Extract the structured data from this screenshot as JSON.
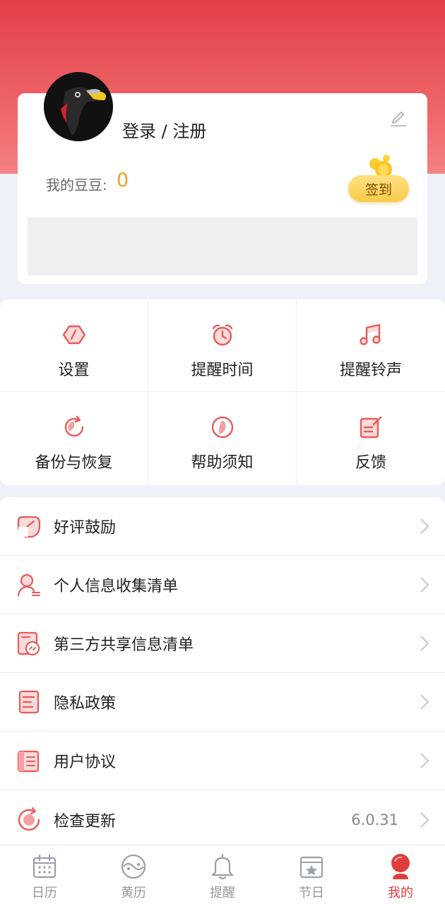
{
  "profile": {
    "login_label": "登录 / 注册",
    "beans_label": "我的豆豆:",
    "beans_value": "0",
    "checkin_label": "签到"
  },
  "grid": [
    {
      "label": "设置",
      "icon": "settings-icon"
    },
    {
      "label": "提醒时间",
      "icon": "alarm-clock-icon"
    },
    {
      "label": "提醒铃声",
      "icon": "music-note-icon"
    },
    {
      "label": "备份与恢复",
      "icon": "backup-restore-icon"
    },
    {
      "label": "帮助须知",
      "icon": "help-icon"
    },
    {
      "label": "反馈",
      "icon": "feedback-icon"
    }
  ],
  "list": [
    {
      "label": "好评鼓励",
      "icon": "rating-heart-icon"
    },
    {
      "label": "个人信息收集清单",
      "icon": "user-info-icon"
    },
    {
      "label": "第三方共享信息清单",
      "icon": "share-link-icon"
    },
    {
      "label": "隐私政策",
      "icon": "privacy-document-icon"
    },
    {
      "label": "用户协议",
      "icon": "agreement-document-icon"
    },
    {
      "label": "检查更新",
      "icon": "update-refresh-icon",
      "value": "6.0.31"
    }
  ],
  "tabs": [
    {
      "label": "日历",
      "icon": "calendar-icon",
      "active": false
    },
    {
      "label": "黄历",
      "icon": "almanac-icon",
      "active": false
    },
    {
      "label": "提醒",
      "icon": "bell-icon",
      "active": false
    },
    {
      "label": "节日",
      "icon": "festival-icon",
      "active": false
    },
    {
      "label": "我的",
      "icon": "profile-icon",
      "active": true
    }
  ],
  "colors": {
    "accent": "#e03d3d",
    "icon_red": "#e85a5a",
    "bean_orange": "#f0a020"
  }
}
